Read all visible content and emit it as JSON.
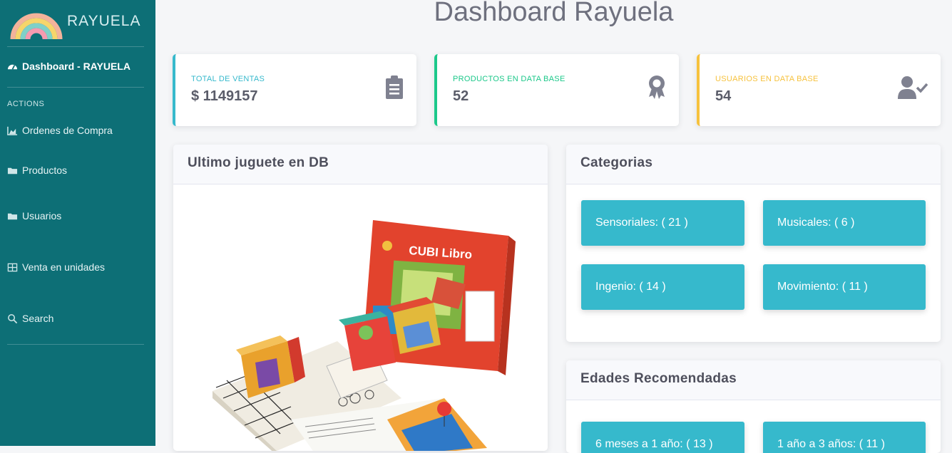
{
  "sidebar": {
    "brand": "RAYUELA",
    "dashboard_link": "Dashboard - RAYUELA",
    "section_heading": "ACTIONS",
    "items": [
      {
        "label": "Ordenes de Compra",
        "icon": "chart-area-icon"
      },
      {
        "label": "Productos",
        "icon": "folder-icon"
      },
      {
        "label": "Usuarios",
        "icon": "folder-icon"
      },
      {
        "label": "Venta en unidades",
        "icon": "table-icon"
      },
      {
        "label": "Search",
        "icon": "search-icon"
      }
    ]
  },
  "main": {
    "title": "Dashboard Rayuela",
    "stats": [
      {
        "label": "Total de ventas",
        "value": "$ 1149157",
        "color": "#36b9cc",
        "icon": "clipboard-list-icon"
      },
      {
        "label": "Productos en Data Base",
        "value": "52",
        "color": "#1cc88a",
        "icon": "award-icon"
      },
      {
        "label": "Usuarios en Data Base",
        "value": "54",
        "color": "#f6c23e",
        "icon": "user-check-icon"
      }
    ],
    "last_toy": {
      "title": "Ultimo juguete en DB",
      "image": "CUBI Libro"
    },
    "categories": {
      "title": "Categorias",
      "items": [
        "Sensoriales: ( 21 )",
        "Musicales: ( 6 )",
        "Ingenio: ( 14 )",
        "Movimiento: ( 11 )"
      ]
    },
    "ages": {
      "title": "Edades Recomendadas",
      "items": [
        "6 meses a 1 año: ( 13 )",
        "1 año a 3 años: ( 11 )"
      ]
    }
  },
  "colors": {
    "sidebar": "#0d6f76",
    "tile": "#36b9cc",
    "info": "#36b9cc",
    "success": "#1cc88a",
    "warning": "#f6c23e"
  }
}
